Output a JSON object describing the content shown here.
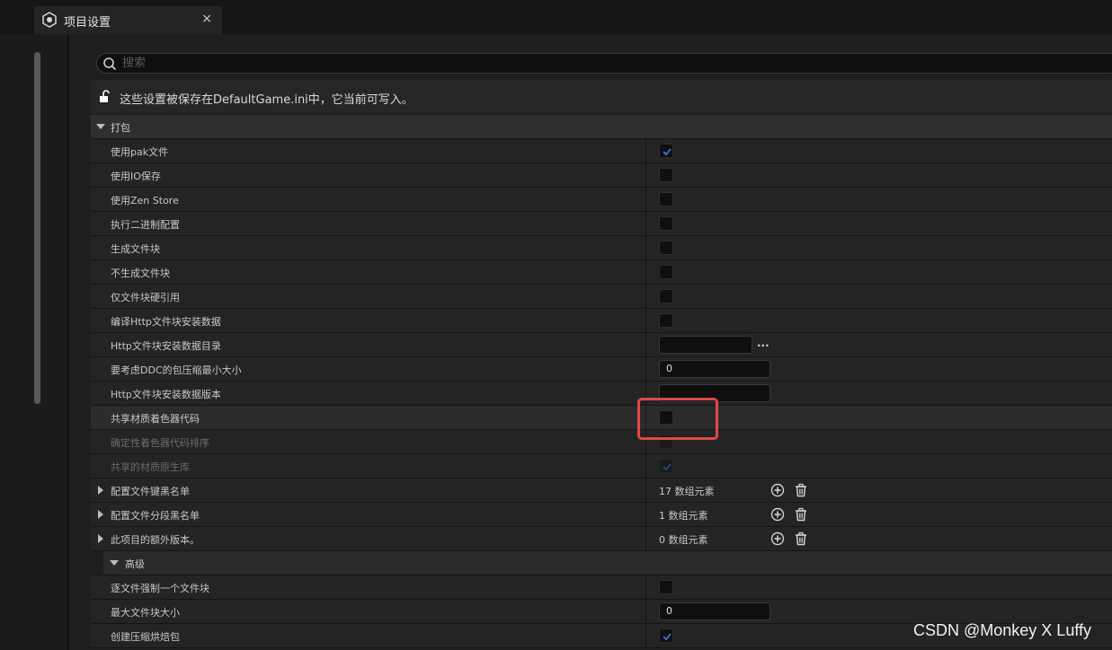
{
  "tab": {
    "title": "项目设置",
    "close": "×"
  },
  "search": {
    "placeholder": "搜索",
    "value": ""
  },
  "notice": {
    "text": "这些设置被保存在DefaultGame.ini中，它当前可写入。"
  },
  "colors": {
    "accent": "#2f6fd6",
    "highlight_box": "#e04848",
    "background": "#1e1e1e"
  },
  "section": {
    "label": "打包"
  },
  "rows": [
    {
      "label": "使用pak文件",
      "type": "checkbox",
      "checked": true
    },
    {
      "label": "使用IO保存",
      "type": "checkbox",
      "checked": false
    },
    {
      "label": "使用Zen Store",
      "type": "checkbox",
      "checked": false
    },
    {
      "label": "执行二进制配置",
      "type": "checkbox",
      "checked": false
    },
    {
      "label": "生成文件块",
      "type": "checkbox",
      "checked": false
    },
    {
      "label": "不生成文件块",
      "type": "checkbox",
      "checked": false
    },
    {
      "label": "仅文件块硬引用",
      "type": "checkbox",
      "checked": false
    },
    {
      "label": "编译Http文件块安装数据",
      "type": "checkbox",
      "checked": false
    },
    {
      "label": "Http文件块安装数据目录",
      "type": "path",
      "value": "",
      "button": "..."
    },
    {
      "label": "要考虑DDC的包压缩最小大小",
      "type": "text",
      "value": "0"
    },
    {
      "label": "Http文件块安装数据版本",
      "type": "text",
      "value": ""
    },
    {
      "label": "共享材质着色器代码",
      "type": "checkbox",
      "checked": false
    },
    {
      "label": "确定性着色器代码排序",
      "type": "checkbox",
      "checked": false
    },
    {
      "label": "共享的材质原生库",
      "type": "checkbox",
      "checked": true
    },
    {
      "label": "配置文件键黑名单",
      "type": "array",
      "value": "17 数组元素"
    },
    {
      "label": "配置文件分段黑名单",
      "type": "array",
      "value": "1 数组元素"
    },
    {
      "label": "此项目的额外版本。",
      "type": "array",
      "value": "0 数组元素"
    }
  ],
  "subsection": {
    "label": "高级"
  },
  "advanced_rows": [
    {
      "label": "逐文件强制一个文件块",
      "type": "checkbox",
      "checked": false
    },
    {
      "label": "最大文件块大小",
      "type": "text",
      "value": "0"
    },
    {
      "label": "创建压缩烘焙包",
      "type": "checkbox",
      "checked": true
    }
  ],
  "watermark": "CSDN @Monkey X Luffy",
  "icons": [
    "unreal-logo-icon",
    "close-icon",
    "search-icon",
    "lock-open-icon",
    "triangle-down-icon",
    "triangle-right-icon",
    "checkmark-icon",
    "add-circle-icon",
    "trash-icon",
    "ellipsis-icon"
  ]
}
